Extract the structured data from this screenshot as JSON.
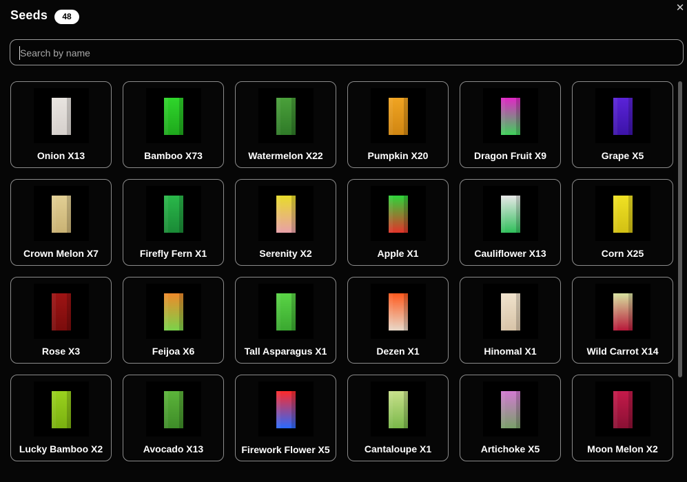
{
  "header": {
    "title": "Seeds",
    "count": "48"
  },
  "search": {
    "placeholder": "Search by name",
    "value": ""
  },
  "close_icon": "close-icon",
  "seeds": [
    {
      "label": "Onion X13",
      "colors": [
        "#e8e4e0",
        "#d6d0cc"
      ]
    },
    {
      "label": "Bamboo X73",
      "colors": [
        "#2fd62b",
        "#1ea81c"
      ]
    },
    {
      "label": "Watermelon X22",
      "colors": [
        "#4aa03a",
        "#2f7a28"
      ]
    },
    {
      "label": "Pumpkin X20",
      "colors": [
        "#f0a422",
        "#d08612"
      ]
    },
    {
      "label": "Dragon Fruit X9",
      "colors": [
        "#e027c6",
        "#3fd25a"
      ]
    },
    {
      "label": "Grape X5",
      "colors": [
        "#5a23d8",
        "#3c13a8"
      ]
    },
    {
      "label": "Crown Melon X7",
      "colors": [
        "#e2cf94",
        "#c9b274"
      ]
    },
    {
      "label": "Firefly Fern X1",
      "colors": [
        "#2ab84a",
        "#1a8a36"
      ]
    },
    {
      "label": "Serenity X2",
      "colors": [
        "#e8dc2a",
        "#e8a0a8"
      ]
    },
    {
      "label": "Apple X1",
      "colors": [
        "#2ed43a",
        "#e2342a"
      ]
    },
    {
      "label": "Cauliflower X13",
      "colors": [
        "#e8e8e8",
        "#2fbf5a"
      ]
    },
    {
      "label": "Corn X25",
      "colors": [
        "#f0e224",
        "#d2c014"
      ]
    },
    {
      "label": "Rose X3",
      "colors": [
        "#9e1414",
        "#7a0c0c"
      ]
    },
    {
      "label": "Feijoa X6",
      "colors": [
        "#f08a2a",
        "#7ad24a"
      ]
    },
    {
      "label": "Tall Asparagus X1",
      "colors": [
        "#5ad446",
        "#3aa830"
      ]
    },
    {
      "label": "Dezen X1",
      "colors": [
        "#ff5a1e",
        "#e8d8c8"
      ]
    },
    {
      "label": "Hinomal X1",
      "colors": [
        "#f0e2cc",
        "#d8c4a8"
      ]
    },
    {
      "label": "Wild Carrot X14",
      "colors": [
        "#d8e2a0",
        "#b8183a"
      ]
    },
    {
      "label": "Lucky Bamboo X2",
      "colors": [
        "#9ad21e",
        "#7ab010"
      ]
    },
    {
      "label": "Avocado X13",
      "colors": [
        "#5cb43a",
        "#3e8c28"
      ]
    },
    {
      "label": "Firework Flower X5",
      "colors": [
        "#ff2a2a",
        "#2a6aff"
      ]
    },
    {
      "label": "Cantaloupe X1",
      "colors": [
        "#c8e08a",
        "#7ab84a"
      ]
    },
    {
      "label": "Artichoke X5",
      "colors": [
        "#d27ad2",
        "#7aa06a"
      ]
    },
    {
      "label": "Moon Melon X2",
      "colors": [
        "#c41a4a",
        "#8a1034"
      ]
    }
  ]
}
